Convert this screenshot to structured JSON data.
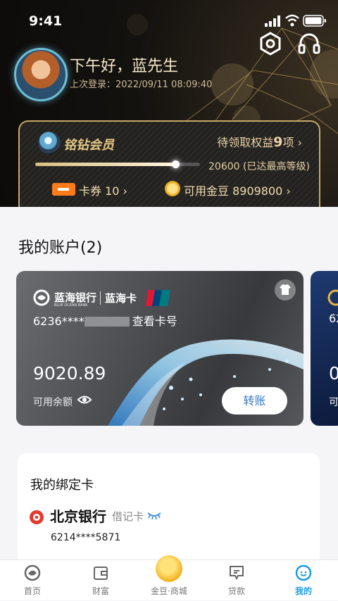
{
  "status_bar": {
    "time": "9:41"
  },
  "header": {
    "greeting": "下午好，蓝先生",
    "last_login": "上次登录：2022/09/11 08:09:40"
  },
  "membership": {
    "title": "铭钻会员",
    "rights_text": "待领取权益",
    "rights_count": "9",
    "rights_unit": "项 ›",
    "progress_fraction": 0.85,
    "points_text": "20600 (已达最高等级)",
    "coupon_label": "卡券 10 ›",
    "beans_label": "可用金豆 8909800 ›"
  },
  "accounts": {
    "title": "我的账户(2)",
    "card": {
      "bank_name": "蓝海银行",
      "bank_name_en": "BLUE OCEAN BANK",
      "card_name": "蓝海卡",
      "number_prefix": "6236****",
      "view_number": "查看卡号",
      "balance": "9020.89",
      "balance_label": "可用余额",
      "transfer_label": "转账"
    },
    "card2_peek": {
      "number": "62",
      "balance": "0",
      "label": "可"
    }
  },
  "bound_cards": {
    "title": "我的绑定卡",
    "bank": "北京银行",
    "type": "借记卡",
    "number": "6214****5871"
  },
  "tabbar": {
    "items": [
      {
        "label": "首页",
        "icon": "home-logo-icon"
      },
      {
        "label": "财富",
        "icon": "wallet-icon"
      },
      {
        "label": "金豆·商城",
        "icon": "gold-bean-icon"
      },
      {
        "label": "贷款",
        "icon": "loan-icon"
      },
      {
        "label": "我的",
        "icon": "profile-icon"
      }
    ],
    "active": 4
  },
  "colors": {
    "gold": "#e5c886",
    "accent_blue": "#3779c8",
    "active_tab": "#1a9be6",
    "coupon_orange": "#ff7a1a"
  }
}
